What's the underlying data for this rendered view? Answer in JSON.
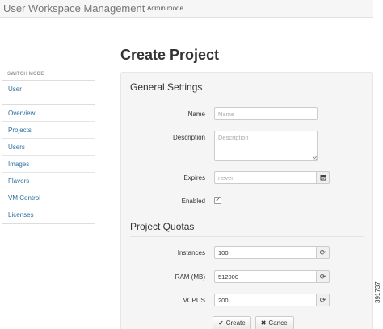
{
  "navbar": {
    "brand": "User Workspace Management",
    "mode_link": "Admin mode"
  },
  "figure_id": "391737",
  "sidebar": {
    "header": "SWITCH MODE",
    "mode_items": [
      {
        "label": "User"
      }
    ],
    "items": [
      {
        "label": "Overview"
      },
      {
        "label": "Projects"
      },
      {
        "label": "Users"
      },
      {
        "label": "Images"
      },
      {
        "label": "Flavors"
      },
      {
        "label": "VM Control"
      },
      {
        "label": "Licenses"
      }
    ]
  },
  "page": {
    "title": "Create Project"
  },
  "general_settings": {
    "title": "General Settings",
    "name": {
      "label": "Name",
      "value": "",
      "placeholder": "Name"
    },
    "description": {
      "label": "Description",
      "value": "",
      "placeholder": "Description"
    },
    "expires": {
      "label": "Expires",
      "value": "",
      "placeholder": "never",
      "icon": "calendar-icon"
    },
    "enabled": {
      "label": "Enabled",
      "checked": true,
      "check_glyph": "✓"
    }
  },
  "project_quotas": {
    "title": "Project Quotas",
    "instances": {
      "label": "Instances",
      "value": "100",
      "icon": "refresh-icon"
    },
    "ram": {
      "label": "RAM (MB)",
      "value": "512000",
      "icon": "refresh-icon"
    },
    "vcpus": {
      "label": "VCPUS",
      "value": "200",
      "icon": "refresh-icon"
    }
  },
  "actions": {
    "create_label": "Create",
    "create_icon_glyph": "✔",
    "cancel_label": "Cancel",
    "cancel_icon_glyph": "✖"
  },
  "colors": {
    "link": "#2a6d9e",
    "panel_bg": "#f5f5f5",
    "navbar_bg": "#f6f6f6"
  }
}
